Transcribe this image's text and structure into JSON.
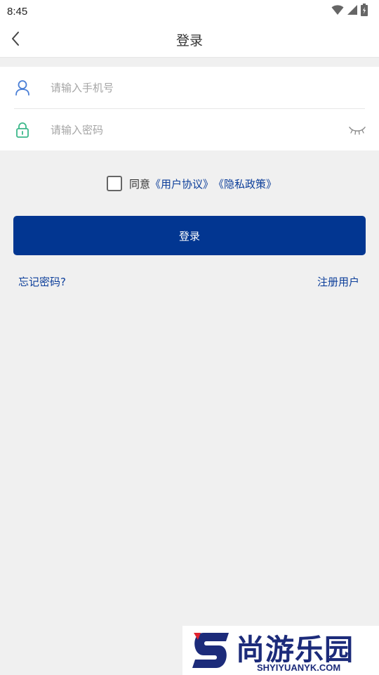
{
  "status_bar": {
    "time": "8:45",
    "icons": [
      "wifi-icon",
      "signal-icon",
      "battery-icon"
    ]
  },
  "nav": {
    "title": "登录",
    "back_icon": "chevron-left-icon"
  },
  "form": {
    "phone": {
      "placeholder": "请输入手机号",
      "value": "",
      "icon": "user-icon",
      "icon_color": "#4a7fd6"
    },
    "password": {
      "placeholder": "请输入密码",
      "value": "",
      "icon": "lock-icon",
      "icon_color": "#3cb88a",
      "toggle_icon": "eye-closed-icon"
    }
  },
  "agreement": {
    "checked": false,
    "prefix": "同意",
    "user_agreement": "《用户协议》",
    "privacy_policy": "《隐私政策》"
  },
  "login_button": "登录",
  "forgot_password": "忘记密码?",
  "register": "注册用户",
  "colors": {
    "primary": "#023691",
    "link": "#0c3e9a",
    "background": "#f0f0f0"
  },
  "watermark": {
    "name": "尚游乐园",
    "url": "SHYIYUANYK.COM"
  }
}
